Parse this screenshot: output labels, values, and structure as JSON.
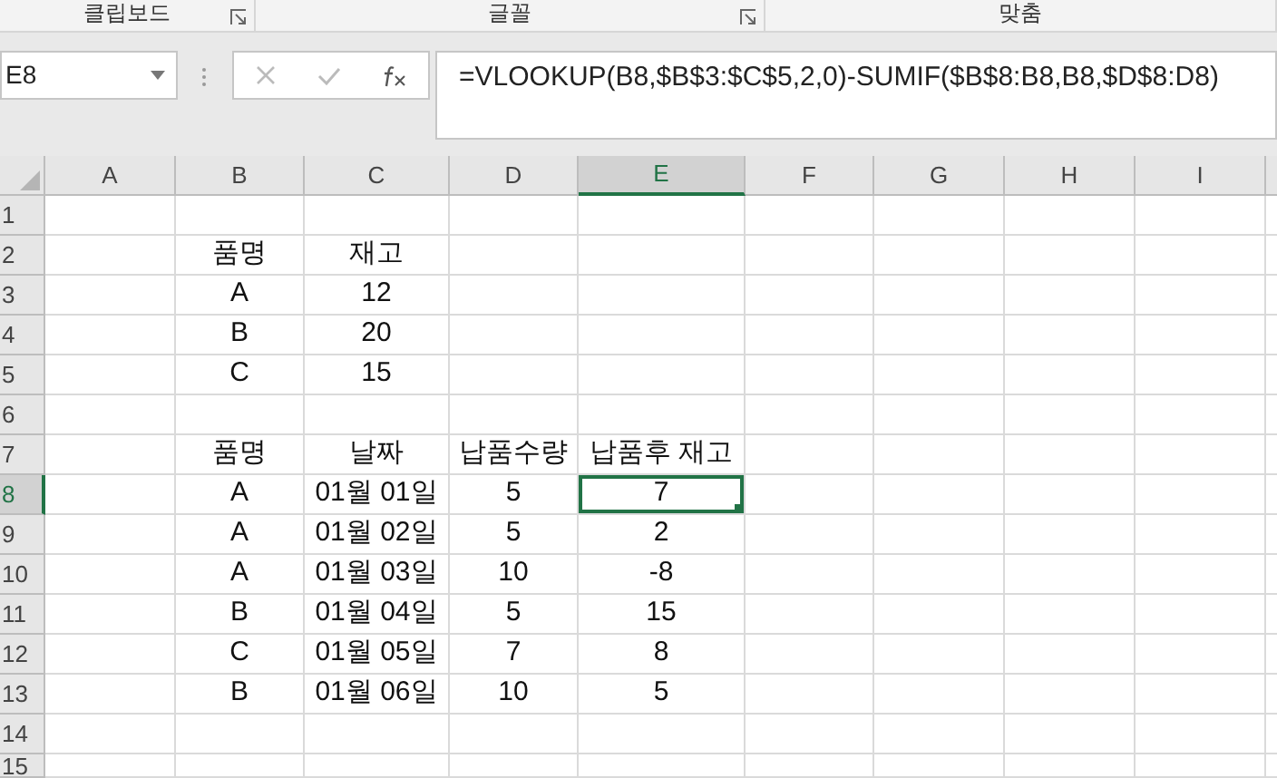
{
  "ribbon_groups": [
    {
      "label": "클립보드",
      "launcher": true
    },
    {
      "label": "글꼴",
      "launcher": true
    },
    {
      "label": "맞춤",
      "launcher": false
    }
  ],
  "name_box": {
    "value": "E8"
  },
  "formula_bar": {
    "value": "=VLOOKUP(B8,$B$3:$C$5,2,0)-SUMIF($B$8:B8,B8,$D$8:D8)"
  },
  "columns": [
    {
      "label": "A",
      "selected": false
    },
    {
      "label": "B",
      "selected": false
    },
    {
      "label": "C",
      "selected": false
    },
    {
      "label": "D",
      "selected": false
    },
    {
      "label": "E",
      "selected": true
    },
    {
      "label": "F",
      "selected": false
    },
    {
      "label": "G",
      "selected": false
    },
    {
      "label": "H",
      "selected": false
    },
    {
      "label": "I",
      "selected": false
    }
  ],
  "rows": [
    {
      "number": "1",
      "selected": false,
      "cells": [
        {
          "selected": false
        },
        {
          "selected": false
        },
        {
          "selected": false
        },
        {
          "selected": false
        },
        {
          "selected": false
        },
        {
          "selected": false
        },
        {
          "selected": false
        },
        {
          "selected": false
        },
        {
          "selected": false
        }
      ]
    },
    {
      "number": "2",
      "selected": false,
      "cells": [
        {
          "selected": false
        },
        {
          "text": "품명",
          "selected": false
        },
        {
          "text": "재고",
          "selected": false
        },
        {
          "selected": false
        },
        {
          "selected": false
        },
        {
          "selected": false
        },
        {
          "selected": false
        },
        {
          "selected": false
        },
        {
          "selected": false
        }
      ]
    },
    {
      "number": "3",
      "selected": false,
      "cells": [
        {
          "selected": false
        },
        {
          "text": "A",
          "selected": false
        },
        {
          "text": "12",
          "selected": false
        },
        {
          "selected": false
        },
        {
          "selected": false
        },
        {
          "selected": false
        },
        {
          "selected": false
        },
        {
          "selected": false
        },
        {
          "selected": false
        }
      ]
    },
    {
      "number": "4",
      "selected": false,
      "cells": [
        {
          "selected": false
        },
        {
          "text": "B",
          "selected": false
        },
        {
          "text": "20",
          "selected": false
        },
        {
          "selected": false
        },
        {
          "selected": false
        },
        {
          "selected": false
        },
        {
          "selected": false
        },
        {
          "selected": false
        },
        {
          "selected": false
        }
      ]
    },
    {
      "number": "5",
      "selected": false,
      "cells": [
        {
          "selected": false
        },
        {
          "text": "C",
          "selected": false
        },
        {
          "text": "15",
          "selected": false
        },
        {
          "selected": false
        },
        {
          "selected": false
        },
        {
          "selected": false
        },
        {
          "selected": false
        },
        {
          "selected": false
        },
        {
          "selected": false
        }
      ]
    },
    {
      "number": "6",
      "selected": false,
      "cells": [
        {
          "selected": false
        },
        {
          "selected": false
        },
        {
          "selected": false
        },
        {
          "selected": false
        },
        {
          "selected": false
        },
        {
          "selected": false
        },
        {
          "selected": false
        },
        {
          "selected": false
        },
        {
          "selected": false
        }
      ]
    },
    {
      "number": "7",
      "selected": false,
      "cells": [
        {
          "selected": false
        },
        {
          "text": "품명",
          "selected": false
        },
        {
          "text": "날짜",
          "selected": false
        },
        {
          "text": "납품수량",
          "selected": false
        },
        {
          "text": "납품후 재고",
          "selected": false
        },
        {
          "selected": false
        },
        {
          "selected": false
        },
        {
          "selected": false
        },
        {
          "selected": false
        }
      ]
    },
    {
      "number": "8",
      "selected": true,
      "cells": [
        {
          "selected": false
        },
        {
          "text": "A",
          "selected": false
        },
        {
          "text": "01월 01일",
          "selected": false
        },
        {
          "text": "5",
          "selected": false
        },
        {
          "text": "7",
          "selected": true
        },
        {
          "selected": false
        },
        {
          "selected": false
        },
        {
          "selected": false
        },
        {
          "selected": false
        }
      ]
    },
    {
      "number": "9",
      "selected": false,
      "cells": [
        {
          "selected": false
        },
        {
          "text": "A",
          "selected": false
        },
        {
          "text": "01월 02일",
          "selected": false
        },
        {
          "text": "5",
          "selected": false
        },
        {
          "text": "2",
          "selected": false
        },
        {
          "selected": false
        },
        {
          "selected": false
        },
        {
          "selected": false
        },
        {
          "selected": false
        }
      ]
    },
    {
      "number": "10",
      "selected": false,
      "cells": [
        {
          "selected": false
        },
        {
          "text": "A",
          "selected": false
        },
        {
          "text": "01월 03일",
          "selected": false
        },
        {
          "text": "10",
          "selected": false
        },
        {
          "text": "-8",
          "selected": false
        },
        {
          "selected": false
        },
        {
          "selected": false
        },
        {
          "selected": false
        },
        {
          "selected": false
        }
      ]
    },
    {
      "number": "11",
      "selected": false,
      "cells": [
        {
          "selected": false
        },
        {
          "text": "B",
          "selected": false
        },
        {
          "text": "01월 04일",
          "selected": false
        },
        {
          "text": "5",
          "selected": false
        },
        {
          "text": "15",
          "selected": false
        },
        {
          "selected": false
        },
        {
          "selected": false
        },
        {
          "selected": false
        },
        {
          "selected": false
        }
      ]
    },
    {
      "number": "12",
      "selected": false,
      "cells": [
        {
          "selected": false
        },
        {
          "text": "C",
          "selected": false
        },
        {
          "text": "01월 05일",
          "selected": false
        },
        {
          "text": "7",
          "selected": false
        },
        {
          "text": "8",
          "selected": false
        },
        {
          "selected": false
        },
        {
          "selected": false
        },
        {
          "selected": false
        },
        {
          "selected": false
        }
      ]
    },
    {
      "number": "13",
      "selected": false,
      "cells": [
        {
          "selected": false
        },
        {
          "text": "B",
          "selected": false
        },
        {
          "text": "01월 06일",
          "selected": false
        },
        {
          "text": "10",
          "selected": false
        },
        {
          "text": "5",
          "selected": false
        },
        {
          "selected": false
        },
        {
          "selected": false
        },
        {
          "selected": false
        },
        {
          "selected": false
        }
      ]
    },
    {
      "number": "14",
      "selected": false,
      "cells": [
        {
          "selected": false
        },
        {
          "selected": false
        },
        {
          "selected": false
        },
        {
          "selected": false
        },
        {
          "selected": false
        },
        {
          "selected": false
        },
        {
          "selected": false
        },
        {
          "selected": false
        },
        {
          "selected": false
        }
      ]
    },
    {
      "number": "15",
      "selected": false,
      "cells": [
        {
          "selected": false
        },
        {
          "selected": false
        },
        {
          "selected": false
        },
        {
          "selected": false
        },
        {
          "selected": false
        },
        {
          "selected": false
        },
        {
          "selected": false
        },
        {
          "selected": false
        },
        {
          "selected": false
        }
      ]
    }
  ]
}
